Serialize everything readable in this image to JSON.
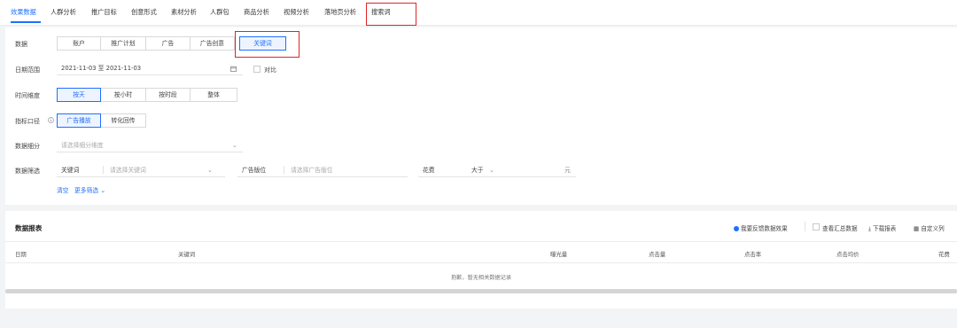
{
  "nav": {
    "tabs": [
      "效果数据",
      "人群分析",
      "推广目标",
      "创意形式",
      "素材分析",
      "人群包",
      "商品分析",
      "视频分析",
      "落地页分析",
      "搜索词"
    ],
    "active_index": 0,
    "highlighted_index": 9
  },
  "filters": {
    "data": {
      "label": "数据",
      "options": [
        "账户",
        "推广计划",
        "广告",
        "广告创意",
        "关键词"
      ],
      "selected": "关键词"
    },
    "date_range": {
      "label": "日期范围",
      "value": "2021-11-03 至 2021-11-03",
      "compare_label": "对比"
    },
    "time_granularity": {
      "label": "时间维度",
      "options": [
        "按天",
        "按小时",
        "按时段",
        "整体"
      ],
      "selected": "按天"
    },
    "metric_basis": {
      "label": "指标口径",
      "options": [
        "广告播放",
        "转化回传"
      ],
      "selected": "广告播放"
    },
    "breakdown": {
      "label": "数据细分",
      "placeholder": "请选择细分维度"
    },
    "screening": {
      "label": "数据筛选",
      "keyword_label": "关键词",
      "keyword_placeholder": "请选择关键词",
      "placement_label": "广告版位",
      "placement_placeholder": "请选择广告版位",
      "cost_label": "花费",
      "operator": "大于",
      "unit": "元"
    },
    "clear_label": "清空",
    "more_label": "更多筛选"
  },
  "report": {
    "title": "数据报表",
    "feedback_label": "我要反馈数据效果",
    "summary_label": "查看汇总数据",
    "download_label": "下载报表",
    "custom_columns_label": "自定义列",
    "columns": [
      "日期",
      "关键词",
      "曝光量",
      "点击量",
      "点击率",
      "点击均价",
      "花费"
    ],
    "empty_text": "抱歉，暂无相关数据记录"
  },
  "colors": {
    "accent": "#1f6fff",
    "highlight": "#e02424"
  }
}
